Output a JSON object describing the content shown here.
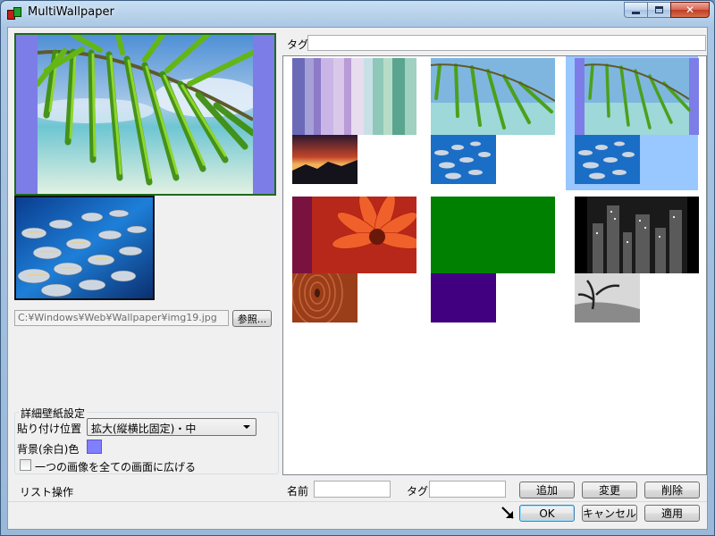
{
  "window": {
    "title": "MultiWallpaper",
    "controls": {
      "minimize": "minimize",
      "maximize": "maximize",
      "close": "✕"
    }
  },
  "preview": {
    "path": "C:¥Windows¥Web¥Wallpaper¥img19.jpg",
    "browse_label": "参照..."
  },
  "settings": {
    "group_title": "詳細壁紙設定",
    "position_label": "貼り付け位置",
    "position_value": "拡大(縦横比固定)・中",
    "bg_label": "背景(余白)色",
    "bg_color": "#8080ff",
    "span_label": "一つの画像を全ての画面に広げる",
    "span_checked": false
  },
  "list": {
    "tag_label": "タグ",
    "tag_value": "",
    "operations_label": "リスト操作",
    "name_label": "名前",
    "name_value": "",
    "tag2_label": "タグ",
    "tag2_value": "",
    "add_label": "追加",
    "change_label": "変更",
    "delete_label": "削除",
    "items": [
      {
        "top": "stripes",
        "bottom": "sunset",
        "selected": false
      },
      {
        "top": "palm",
        "bottom": "fish",
        "selected": false
      },
      {
        "top": "palm-framed",
        "bottom": "fish",
        "selected": true
      },
      {
        "top": "flower",
        "bottom": "wood",
        "selected": false
      },
      {
        "top": "green",
        "bottom": "purple",
        "selected": false
      },
      {
        "top": "city",
        "bottom": "tree",
        "selected": false
      }
    ]
  },
  "footer": {
    "ok_label": "OK",
    "cancel_label": "キャンセル",
    "apply_label": "適用"
  },
  "colors": {
    "accent": "#99c7ff",
    "preview_border": "#1c6b1c",
    "bg_fill": "#8080ff"
  }
}
